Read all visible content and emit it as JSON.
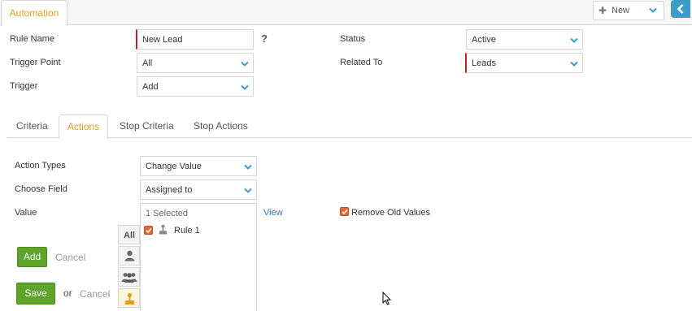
{
  "header": {
    "tab_label": "Automation",
    "new_button_label": "New"
  },
  "rule_form": {
    "rule_name_label": "Rule Name",
    "rule_name_value": "New Lead",
    "help_symbol": "?",
    "trigger_point_label": "Trigger Point",
    "trigger_point_value": "All",
    "trigger_label": "Trigger",
    "trigger_value": "Add",
    "status_label": "Status",
    "status_value": "Active",
    "related_to_label": "Related To",
    "related_to_value": "Leads"
  },
  "tabs": [
    {
      "label": "Criteria",
      "active": false
    },
    {
      "label": "Actions",
      "active": true
    },
    {
      "label": "Stop Criteria",
      "active": false
    },
    {
      "label": "Stop Actions",
      "active": false
    }
  ],
  "actions": {
    "action_types_label": "Action Types",
    "action_types_value": "Change Value",
    "choose_field_label": "Choose Field",
    "choose_field_value": "Assigned to",
    "value_label": "Value",
    "value_summary": "1 Selected",
    "view_link": "View",
    "remove_old_values_label": "Remove Old Values",
    "remove_old_values_checked": true,
    "selector_all_label": "All",
    "selected_items": [
      {
        "label": "Rule 1",
        "checked": true
      }
    ],
    "add_button": "Add",
    "cancel_link": "Cancel"
  },
  "footer": {
    "save_button": "Save",
    "or_text": "or",
    "cancel_link": "Cancel"
  },
  "colors": {
    "accent_orange": "#e0a01c",
    "link_blue": "#3a7ab5",
    "button_green": "#5ea32a",
    "required_red": "#c8202a",
    "checkbox_orange": "#e06a35",
    "collapse_blue": "#3a9fc8"
  }
}
